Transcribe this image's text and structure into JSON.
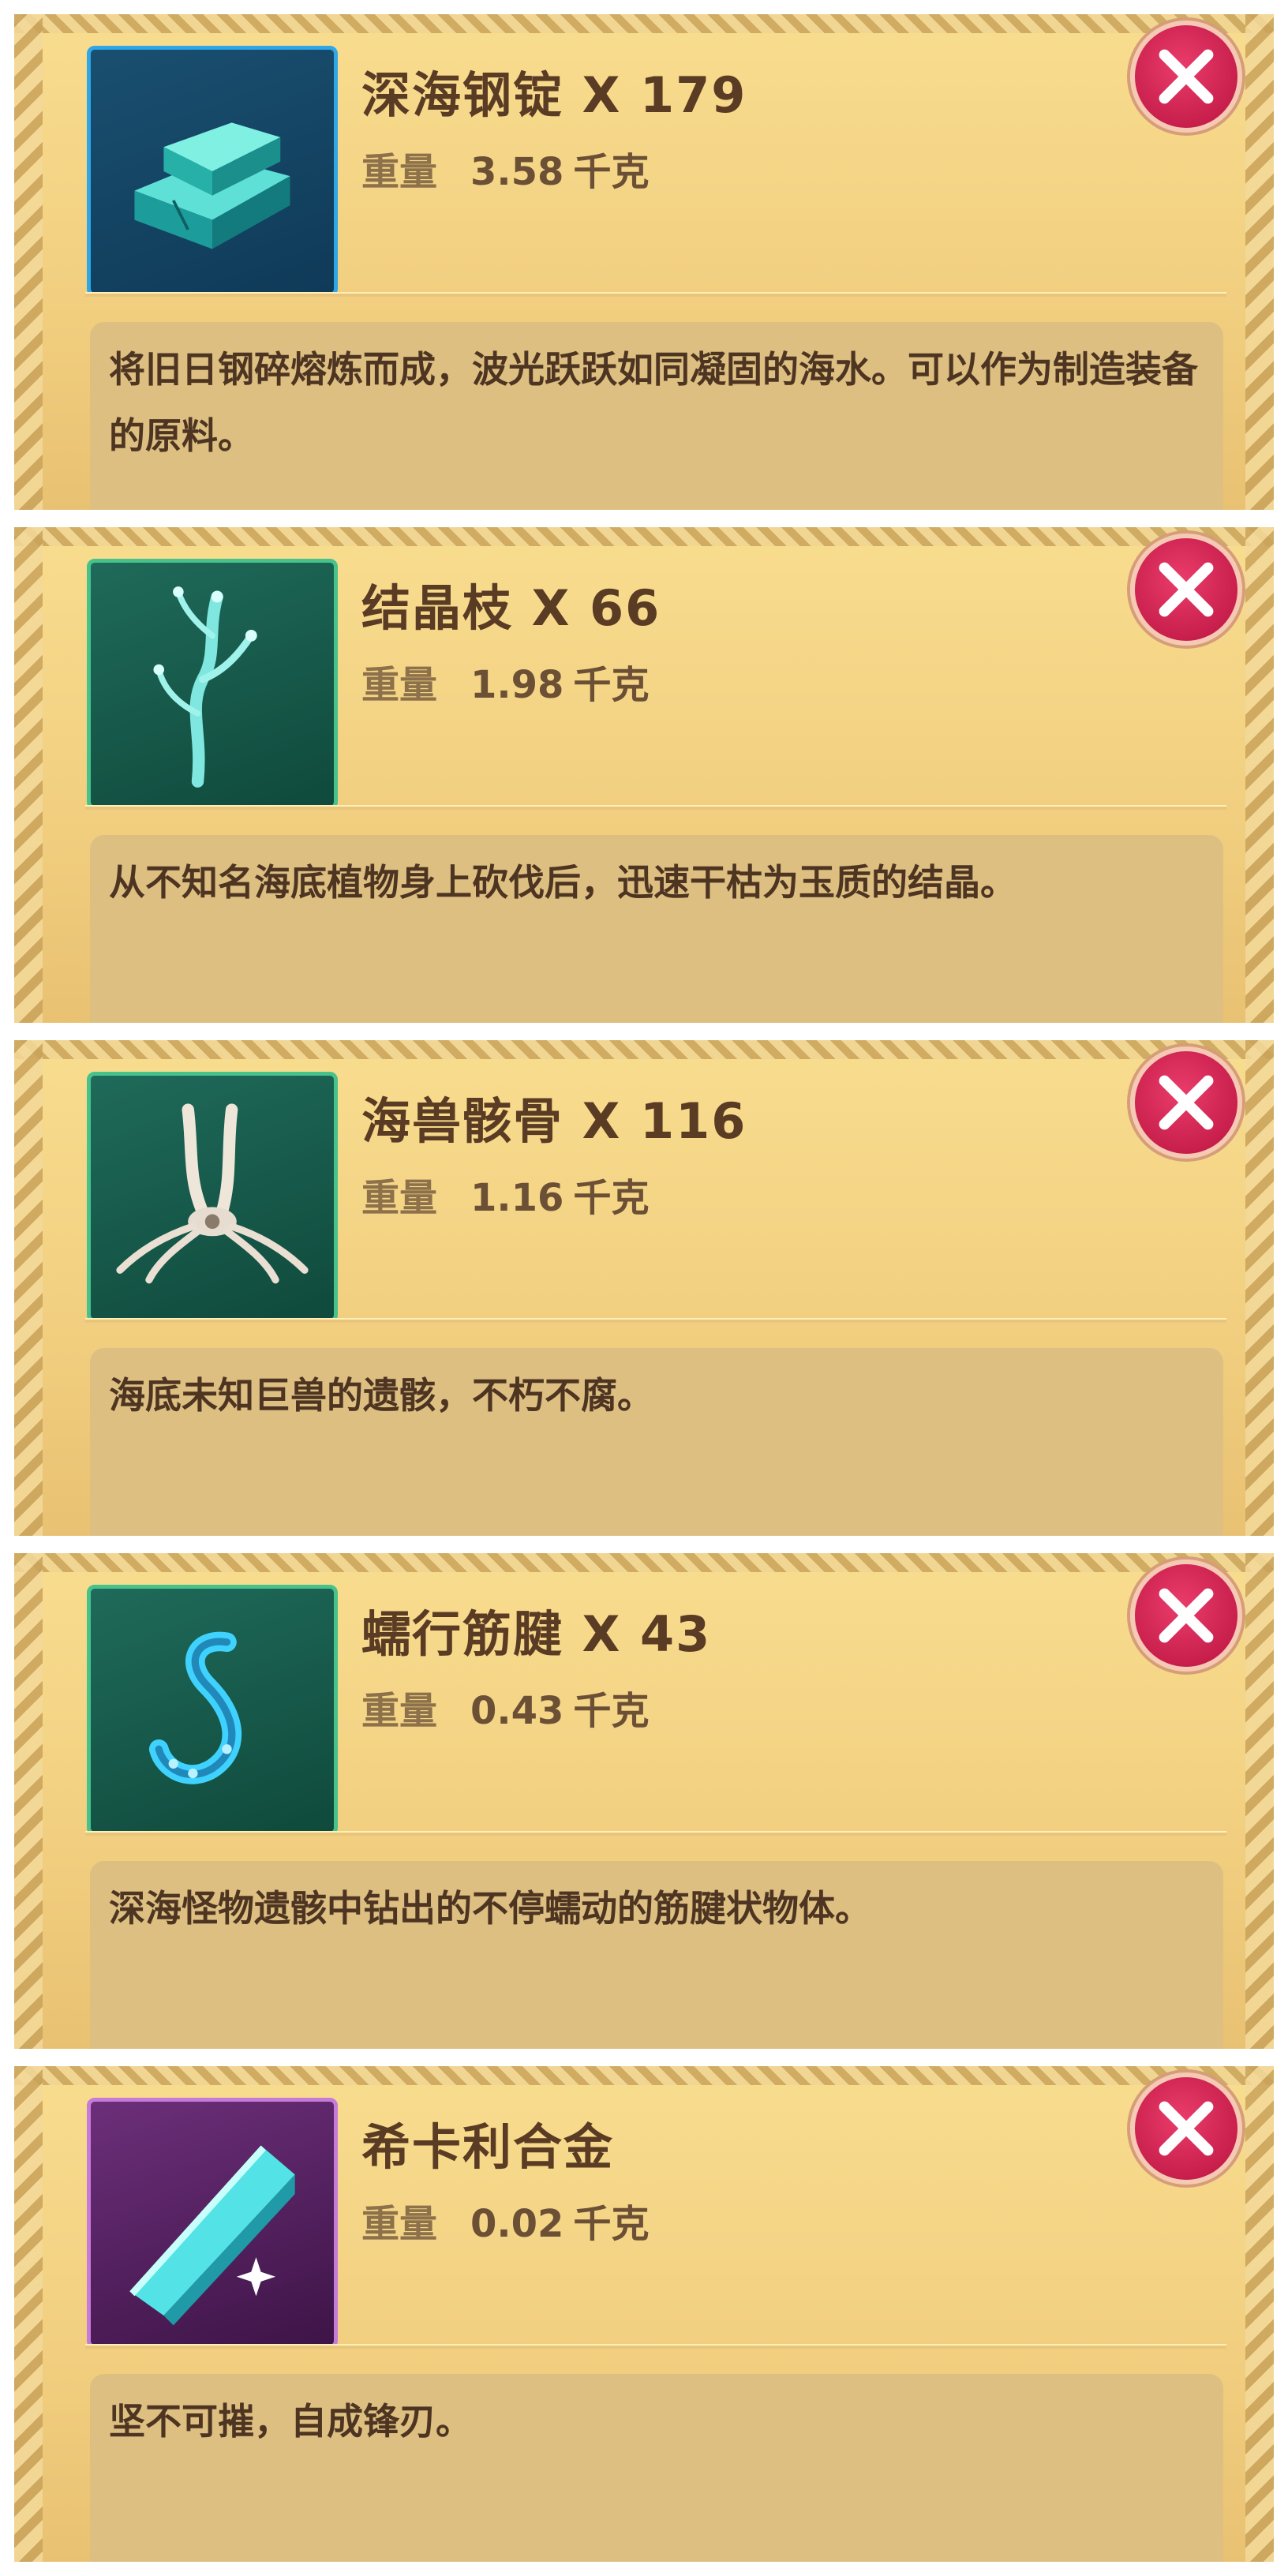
{
  "items": [
    {
      "name": "深海钢锭",
      "count_label": "X 179",
      "weight_label": "重量",
      "weight_value": "3.58",
      "weight_unit": "千克",
      "description": "将旧日钢碎熔炼而成，波光跃跃如同凝固的海水。可以作为制造装备的原料。",
      "icon": "steel-ingot-icon",
      "frame_color": "#2fa6e6"
    },
    {
      "name": "结晶枝",
      "count_label": "X 66",
      "weight_label": "重量",
      "weight_value": "1.98",
      "weight_unit": "千克",
      "description": "从不知名海底植物身上砍伐后，迅速干枯为玉质的结晶。",
      "icon": "crystal-branch-icon",
      "frame_color": "#47c28b"
    },
    {
      "name": "海兽骸骨",
      "count_label": "X 116",
      "weight_label": "重量",
      "weight_value": "1.16",
      "weight_unit": "千克",
      "description": "海底未知巨兽的遗骸，不朽不腐。",
      "icon": "beast-bone-icon",
      "frame_color": "#47c28b"
    },
    {
      "name": "蠕行筋腱",
      "count_label": "X 43",
      "weight_label": "重量",
      "weight_value": "0.43",
      "weight_unit": "千克",
      "description": "深海怪物遗骸中钻出的不停蠕动的筋腱状物体。",
      "icon": "crawling-tendon-icon",
      "frame_color": "#47c28b"
    },
    {
      "name": "希卡利合金",
      "count_label": "",
      "weight_label": "重量",
      "weight_value": "0.02",
      "weight_unit": "千克",
      "description": "坚不可摧，自成锋刃。",
      "icon": "sheikah-alloy-icon",
      "frame_color": "#c67bd9"
    }
  ],
  "close_icon": "close-icon"
}
